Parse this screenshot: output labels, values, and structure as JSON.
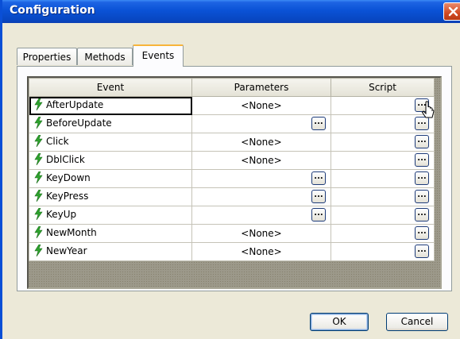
{
  "window": {
    "title": "Configuration"
  },
  "tabs": [
    {
      "label": "Properties"
    },
    {
      "label": "Methods"
    },
    {
      "label": "Events"
    }
  ],
  "grid": {
    "headers": {
      "event": "Event",
      "parameters": "Parameters",
      "script": "Script"
    },
    "rows": [
      {
        "event": "AfterUpdate",
        "parameters": "<None>"
      },
      {
        "event": "BeforeUpdate",
        "parameters": ""
      },
      {
        "event": "Click",
        "parameters": "<None>"
      },
      {
        "event": "DblClick",
        "parameters": "<None>"
      },
      {
        "event": "KeyDown",
        "parameters": ""
      },
      {
        "event": "KeyPress",
        "parameters": ""
      },
      {
        "event": "KeyUp",
        "parameters": ""
      },
      {
        "event": "NewMonth",
        "parameters": "<None>"
      },
      {
        "event": "NewYear",
        "parameters": "<None>"
      }
    ],
    "ellipsis_label": "...",
    "event_icon": "lightning-bolt-icon"
  },
  "buttons": {
    "ok": "OK",
    "cancel": "Cancel"
  },
  "colors": {
    "titlebar": "#0a52d6",
    "active_tab_accent": "#f7b43a",
    "bolt": "#2ea32e"
  }
}
